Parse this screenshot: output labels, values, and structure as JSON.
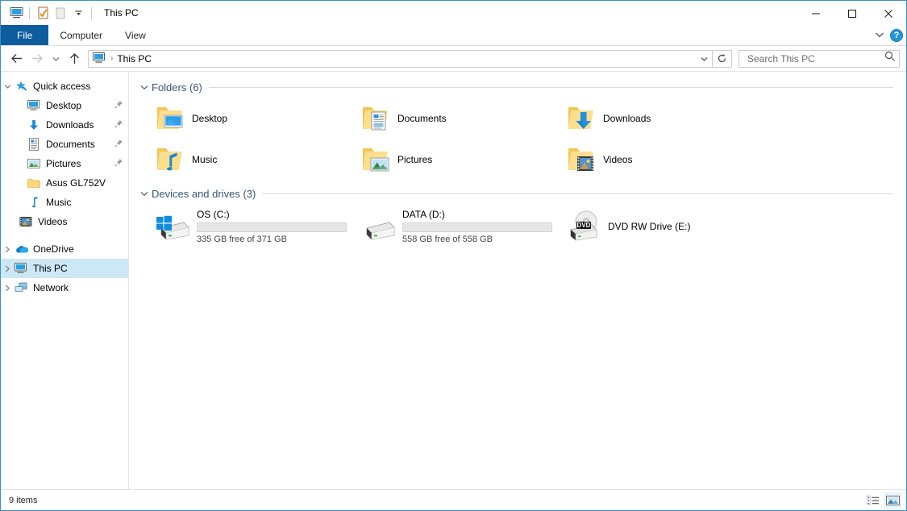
{
  "window": {
    "title": "This PC",
    "quick_access_toolbar": [
      {
        "name": "properties-icon",
        "label": "Properties"
      },
      {
        "name": "new-folder-icon",
        "label": "New folder"
      },
      {
        "name": "customize-qat-chevron-icon",
        "label": "Customize Quick Access Toolbar"
      }
    ],
    "controls": {
      "minimize": "—",
      "maximize": "☐",
      "close": "✕"
    }
  },
  "ribbon": {
    "tabs": [
      {
        "label": "File",
        "active": true
      },
      {
        "label": "Computer",
        "active": false
      },
      {
        "label": "View",
        "active": false
      }
    ],
    "expand_chevron": "⌄",
    "help_label": "?"
  },
  "navigation": {
    "back": "←",
    "forward": "→",
    "recent": "⌄",
    "up": "↑",
    "address_text": "This PC",
    "address_separator": "›",
    "address_dropdown": "⌄",
    "refresh": "↻"
  },
  "search": {
    "placeholder": "Search This PC",
    "value": "",
    "icon": "search-icon"
  },
  "sidebar": {
    "items": [
      {
        "label": "Quick access",
        "icon": "star-pin-icon",
        "chevron": "⌄",
        "indent": 0,
        "pinned": false,
        "selected": false
      },
      {
        "label": "Desktop",
        "icon": "desktop-monitor-icon",
        "chevron": "",
        "indent": 1,
        "pinned": true,
        "selected": false
      },
      {
        "label": "Downloads",
        "icon": "download-arrow-icon",
        "chevron": "",
        "indent": 1,
        "pinned": true,
        "selected": false
      },
      {
        "label": "Documents",
        "icon": "document-icon",
        "chevron": "",
        "indent": 1,
        "pinned": true,
        "selected": false
      },
      {
        "label": "Pictures",
        "icon": "picture-icon",
        "chevron": "",
        "indent": 1,
        "pinned": true,
        "selected": false
      },
      {
        "label": "Asus GL752V",
        "icon": "folder-icon",
        "chevron": "",
        "indent": 1,
        "pinned": false,
        "selected": false
      },
      {
        "label": "Music",
        "icon": "music-note-icon",
        "chevron": "",
        "indent": 1,
        "pinned": false,
        "selected": false
      },
      {
        "label": "Videos",
        "icon": "film-strip-icon",
        "chevron": "",
        "indent": 1,
        "pinned": false,
        "selected": false
      },
      {
        "label": "OneDrive",
        "icon": "onedrive-cloud-icon",
        "chevron": "›",
        "indent": 0,
        "pinned": false,
        "selected": false
      },
      {
        "label": "This PC",
        "icon": "this-pc-monitor-icon",
        "chevron": "›",
        "indent": 0,
        "pinned": false,
        "selected": true
      },
      {
        "label": "Network",
        "icon": "network-icon",
        "chevron": "›",
        "indent": 0,
        "pinned": false,
        "selected": false
      }
    ]
  },
  "content": {
    "groups": [
      {
        "title": "Folders (6)",
        "chevron": "⌄",
        "items": [
          {
            "label": "Desktop",
            "icon": "folder-desktop-icon"
          },
          {
            "label": "Documents",
            "icon": "folder-documents-icon"
          },
          {
            "label": "Downloads",
            "icon": "folder-downloads-icon"
          },
          {
            "label": "Music",
            "icon": "folder-music-icon"
          },
          {
            "label": "Pictures",
            "icon": "folder-pictures-icon"
          },
          {
            "label": "Videos",
            "icon": "folder-videos-icon"
          }
        ]
      }
    ],
    "drives_group": {
      "title": "Devices and drives (3)",
      "chevron": "⌄",
      "drives": [
        {
          "name": "OS (C:)",
          "icon": "hard-drive-windows-icon",
          "free_text": "335 GB free of 371 GB",
          "free_gb": 335,
          "total_gb": 371,
          "used_percent": 10,
          "has_bar": true,
          "bar_color": "#26a0da"
        },
        {
          "name": "DATA (D:)",
          "icon": "hard-drive-icon",
          "free_text": "558 GB free of 558 GB",
          "free_gb": 558,
          "total_gb": 558,
          "used_percent": 0,
          "has_bar": true,
          "bar_color": "#26a0da"
        },
        {
          "name": "DVD RW Drive (E:)",
          "icon": "dvd-drive-icon",
          "badge": "DVD",
          "free_text": "",
          "has_bar": false
        }
      ]
    }
  },
  "statusbar": {
    "item_count": "9 items",
    "views": [
      {
        "name": "details-view-button",
        "active": false
      },
      {
        "name": "large-icons-view-button",
        "active": true
      }
    ]
  },
  "colors": {
    "accent": "#0c5c9e",
    "selection": "#cce8f7",
    "hover": "#e5f3fb",
    "group_header": "#3a5578",
    "drive_bar": "#26a0da",
    "folder_yellow": "#f7d072",
    "border": "#3d8ec4"
  }
}
